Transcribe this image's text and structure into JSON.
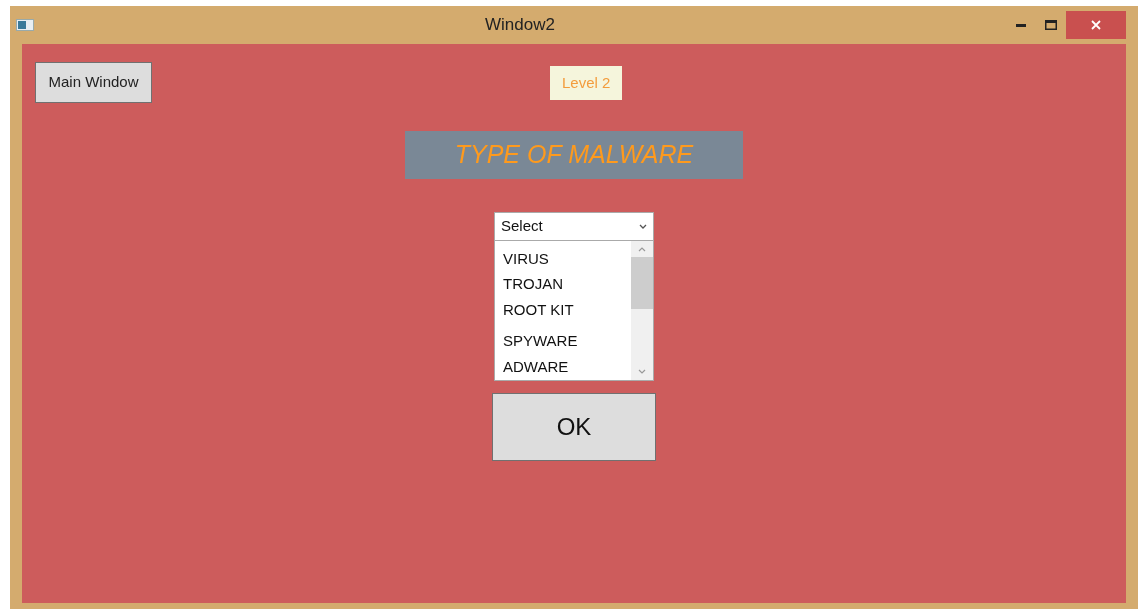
{
  "window": {
    "title": "Window2"
  },
  "main_window_button": "Main Window",
  "level_badge": "Level 2",
  "heading": "TYPE OF MALWARE",
  "dropdown": {
    "value": "Select"
  },
  "list_items": [
    {
      "label": "VIRUS"
    },
    {
      "label": "TROJAN"
    },
    {
      "label": "ROOT KIT"
    },
    {
      "label": "SPYWARE"
    },
    {
      "label": "ADWARE"
    }
  ],
  "ok_button": "OK"
}
